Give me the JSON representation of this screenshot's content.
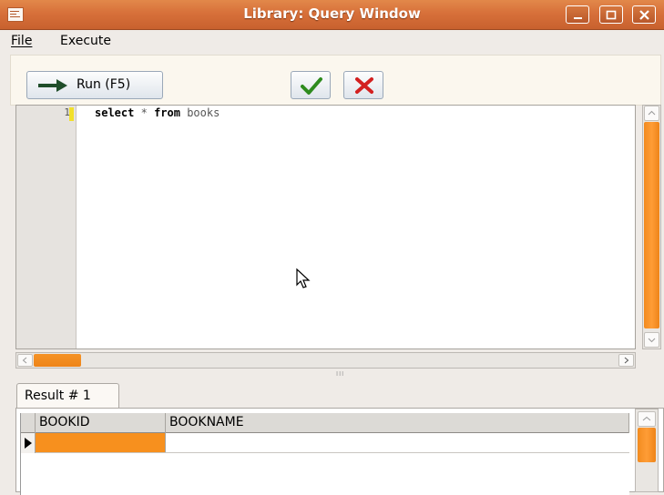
{
  "window": {
    "title": "Library: Query Window",
    "minimize_icon": "minimize-icon",
    "maximize_icon": "maximize-icon",
    "close_icon": "close-icon"
  },
  "menu": {
    "file_label": "File",
    "execute_label": "Execute"
  },
  "toolbar": {
    "run_label": "Run (F5)",
    "run_icon": "arrow-right-icon",
    "commit_icon": "checkmark-icon",
    "rollback_icon": "x-icon"
  },
  "editor": {
    "line_numbers": [
      "1"
    ],
    "keyword_select": "select",
    "operator_star": "*",
    "keyword_from": "from",
    "table_name": "books"
  },
  "splitter": {
    "grip": "III"
  },
  "results": {
    "tab_label": "Result # 1",
    "columns": [
      "BOOKID",
      "BOOKNAME"
    ],
    "rows": [
      [
        "",
        ""
      ]
    ]
  },
  "colors": {
    "accent": "#f7901e",
    "titlebar": "#d7703a",
    "background": "#efebe7"
  }
}
